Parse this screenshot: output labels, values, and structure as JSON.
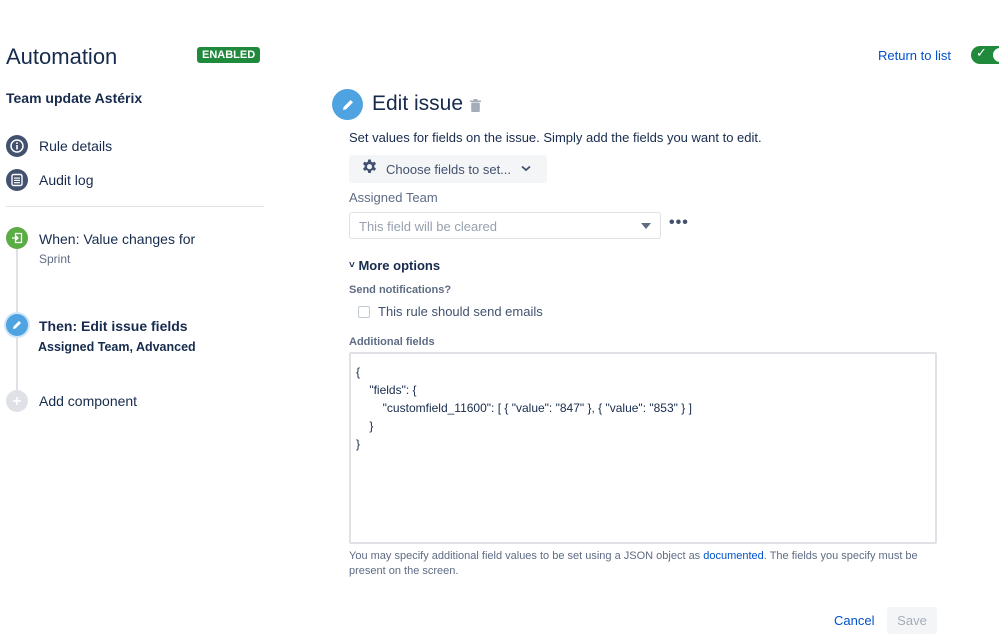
{
  "header": {
    "title": "Automation",
    "status_badge": "ENABLED",
    "return_link": "Return to list",
    "toggle_enabled": true
  },
  "sidebar": {
    "rule_name": "Team update Astérix",
    "items": [
      {
        "label": "Rule details",
        "icon": "info-icon"
      },
      {
        "label": "Audit log",
        "icon": "list-icon"
      }
    ],
    "steps": [
      {
        "title": "When: Value changes for",
        "subtitle": "Sprint",
        "icon": "trigger-icon",
        "color": "#5aac44"
      },
      {
        "title": "Then: Edit issue fields",
        "subtitle": "Assigned Team, Advanced",
        "icon": "pencil-icon",
        "color": "#4fa3e0"
      },
      {
        "title": "Add component",
        "subtitle": "",
        "icon": "plus-icon",
        "color": "#dfe1e6"
      }
    ]
  },
  "editor": {
    "title": "Edit issue",
    "description": "Set values for fields on the issue. Simply add the fields you want to edit.",
    "choose_fields_label": "Choose fields to set...",
    "assigned_team": {
      "label": "Assigned Team",
      "placeholder": "This field will be cleared"
    },
    "more_options_label": "More options",
    "send_notifications_label": "Send notifications?",
    "send_emails_label": "This rule should send emails",
    "send_emails_checked": false,
    "additional_fields_label": "Additional fields",
    "additional_fields_lines": [
      "{",
      "    \"fields\": {",
      "        \"customfield_11600\": [ { \"value\": \"847\" }, { \"value\": \"853\" } ]",
      "    }",
      "}"
    ],
    "help_before": "You may specify additional field values to be set using a JSON object as ",
    "help_link": "documented",
    "help_after": ". The fields you specify must be present on the screen.",
    "cancel_label": "Cancel",
    "save_label": "Save"
  },
  "colors": {
    "accent": "#0052cc",
    "enabled": "#1f8a3c"
  }
}
